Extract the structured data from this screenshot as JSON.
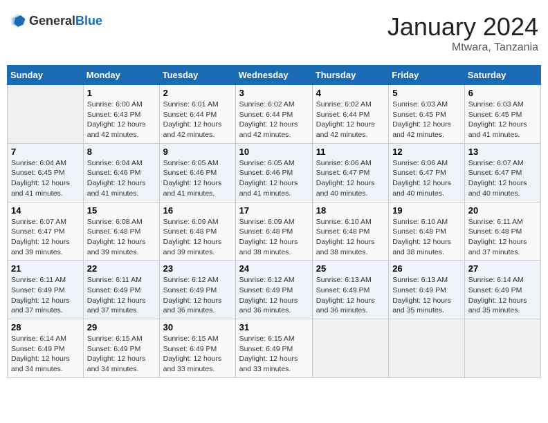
{
  "header": {
    "logo_general": "General",
    "logo_blue": "Blue",
    "month_year": "January 2024",
    "location": "Mtwara, Tanzania"
  },
  "weekdays": [
    "Sunday",
    "Monday",
    "Tuesday",
    "Wednesday",
    "Thursday",
    "Friday",
    "Saturday"
  ],
  "weeks": [
    [
      {
        "day": "",
        "info": ""
      },
      {
        "day": "1",
        "info": "Sunrise: 6:00 AM\nSunset: 6:43 PM\nDaylight: 12 hours\nand 42 minutes."
      },
      {
        "day": "2",
        "info": "Sunrise: 6:01 AM\nSunset: 6:44 PM\nDaylight: 12 hours\nand 42 minutes."
      },
      {
        "day": "3",
        "info": "Sunrise: 6:02 AM\nSunset: 6:44 PM\nDaylight: 12 hours\nand 42 minutes."
      },
      {
        "day": "4",
        "info": "Sunrise: 6:02 AM\nSunset: 6:44 PM\nDaylight: 12 hours\nand 42 minutes."
      },
      {
        "day": "5",
        "info": "Sunrise: 6:03 AM\nSunset: 6:45 PM\nDaylight: 12 hours\nand 42 minutes."
      },
      {
        "day": "6",
        "info": "Sunrise: 6:03 AM\nSunset: 6:45 PM\nDaylight: 12 hours\nand 41 minutes."
      }
    ],
    [
      {
        "day": "7",
        "info": "Sunrise: 6:04 AM\nSunset: 6:45 PM\nDaylight: 12 hours\nand 41 minutes."
      },
      {
        "day": "8",
        "info": "Sunrise: 6:04 AM\nSunset: 6:46 PM\nDaylight: 12 hours\nand 41 minutes."
      },
      {
        "day": "9",
        "info": "Sunrise: 6:05 AM\nSunset: 6:46 PM\nDaylight: 12 hours\nand 41 minutes."
      },
      {
        "day": "10",
        "info": "Sunrise: 6:05 AM\nSunset: 6:46 PM\nDaylight: 12 hours\nand 41 minutes."
      },
      {
        "day": "11",
        "info": "Sunrise: 6:06 AM\nSunset: 6:47 PM\nDaylight: 12 hours\nand 40 minutes."
      },
      {
        "day": "12",
        "info": "Sunrise: 6:06 AM\nSunset: 6:47 PM\nDaylight: 12 hours\nand 40 minutes."
      },
      {
        "day": "13",
        "info": "Sunrise: 6:07 AM\nSunset: 6:47 PM\nDaylight: 12 hours\nand 40 minutes."
      }
    ],
    [
      {
        "day": "14",
        "info": "Sunrise: 6:07 AM\nSunset: 6:47 PM\nDaylight: 12 hours\nand 39 minutes."
      },
      {
        "day": "15",
        "info": "Sunrise: 6:08 AM\nSunset: 6:48 PM\nDaylight: 12 hours\nand 39 minutes."
      },
      {
        "day": "16",
        "info": "Sunrise: 6:09 AM\nSunset: 6:48 PM\nDaylight: 12 hours\nand 39 minutes."
      },
      {
        "day": "17",
        "info": "Sunrise: 6:09 AM\nSunset: 6:48 PM\nDaylight: 12 hours\nand 38 minutes."
      },
      {
        "day": "18",
        "info": "Sunrise: 6:10 AM\nSunset: 6:48 PM\nDaylight: 12 hours\nand 38 minutes."
      },
      {
        "day": "19",
        "info": "Sunrise: 6:10 AM\nSunset: 6:48 PM\nDaylight: 12 hours\nand 38 minutes."
      },
      {
        "day": "20",
        "info": "Sunrise: 6:11 AM\nSunset: 6:48 PM\nDaylight: 12 hours\nand 37 minutes."
      }
    ],
    [
      {
        "day": "21",
        "info": "Sunrise: 6:11 AM\nSunset: 6:49 PM\nDaylight: 12 hours\nand 37 minutes."
      },
      {
        "day": "22",
        "info": "Sunrise: 6:11 AM\nSunset: 6:49 PM\nDaylight: 12 hours\nand 37 minutes."
      },
      {
        "day": "23",
        "info": "Sunrise: 6:12 AM\nSunset: 6:49 PM\nDaylight: 12 hours\nand 36 minutes."
      },
      {
        "day": "24",
        "info": "Sunrise: 6:12 AM\nSunset: 6:49 PM\nDaylight: 12 hours\nand 36 minutes."
      },
      {
        "day": "25",
        "info": "Sunrise: 6:13 AM\nSunset: 6:49 PM\nDaylight: 12 hours\nand 36 minutes."
      },
      {
        "day": "26",
        "info": "Sunrise: 6:13 AM\nSunset: 6:49 PM\nDaylight: 12 hours\nand 35 minutes."
      },
      {
        "day": "27",
        "info": "Sunrise: 6:14 AM\nSunset: 6:49 PM\nDaylight: 12 hours\nand 35 minutes."
      }
    ],
    [
      {
        "day": "28",
        "info": "Sunrise: 6:14 AM\nSunset: 6:49 PM\nDaylight: 12 hours\nand 34 minutes."
      },
      {
        "day": "29",
        "info": "Sunrise: 6:15 AM\nSunset: 6:49 PM\nDaylight: 12 hours\nand 34 minutes."
      },
      {
        "day": "30",
        "info": "Sunrise: 6:15 AM\nSunset: 6:49 PM\nDaylight: 12 hours\nand 33 minutes."
      },
      {
        "day": "31",
        "info": "Sunrise: 6:15 AM\nSunset: 6:49 PM\nDaylight: 12 hours\nand 33 minutes."
      },
      {
        "day": "",
        "info": ""
      },
      {
        "day": "",
        "info": ""
      },
      {
        "day": "",
        "info": ""
      }
    ]
  ]
}
